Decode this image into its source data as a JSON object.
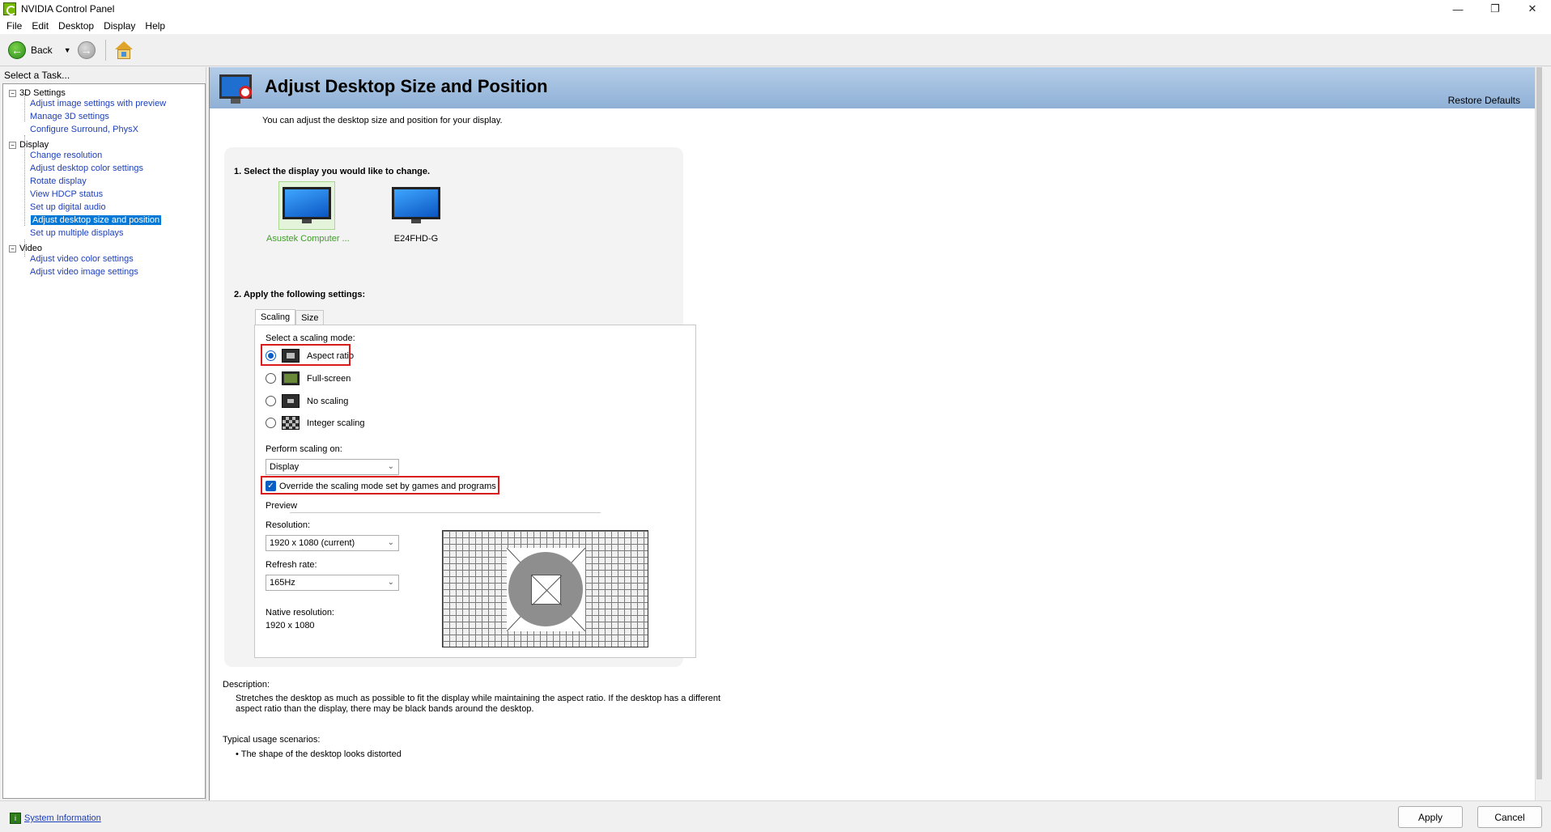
{
  "window": {
    "title": "NVIDIA Control Panel",
    "minimize": "—",
    "maximize": "❐",
    "close": "✕"
  },
  "menu": [
    "File",
    "Edit",
    "Desktop",
    "Display",
    "Help"
  ],
  "toolbar": {
    "back_label": "Back"
  },
  "sidebar": {
    "header": "Select a Task...",
    "groups": [
      {
        "label": "3D Settings",
        "items": [
          "Adjust image settings with preview",
          "Manage 3D settings",
          "Configure Surround, PhysX"
        ]
      },
      {
        "label": "Display",
        "items": [
          "Change resolution",
          "Adjust desktop color settings",
          "Rotate display",
          "View HDCP status",
          "Set up digital audio",
          "Adjust desktop size and position",
          "Set up multiple displays"
        ]
      },
      {
        "label": "Video",
        "items": [
          "Adjust video color settings",
          "Adjust video image settings"
        ]
      }
    ],
    "selected_item": "Adjust desktop size and position"
  },
  "main": {
    "title": "Adjust Desktop Size and Position",
    "restore_defaults": "Restore Defaults",
    "intro": "You can adjust the desktop size and position for your display.",
    "step1": "1. Select the display you would like to change.",
    "displays": [
      {
        "name": "Asustek Computer ...",
        "selected": true
      },
      {
        "name": "E24FHD-G",
        "selected": false
      }
    ],
    "step2": "2. Apply the following settings:",
    "tabs": [
      "Scaling",
      "Size"
    ],
    "active_tab": "Scaling",
    "scaling_mode_label": "Select a scaling mode:",
    "scaling_modes": [
      {
        "label": "Aspect ratio",
        "selected": true,
        "icon": "aspect-ratio-icon"
      },
      {
        "label": "Full-screen",
        "selected": false,
        "icon": "full-screen-icon"
      },
      {
        "label": "No scaling",
        "selected": false,
        "icon": "no-scaling-icon"
      },
      {
        "label": "Integer scaling",
        "selected": false,
        "icon": "integer-scaling-icon"
      }
    ],
    "perform_scaling_label": "Perform scaling on:",
    "perform_scaling_value": "Display",
    "override_label": "Override the scaling mode set by games and programs",
    "override_checked": true,
    "preview_label": "Preview",
    "resolution_label": "Resolution:",
    "resolution_value": "1920 x 1080 (current)",
    "refresh_label": "Refresh rate:",
    "refresh_value": "165Hz",
    "native_label": "Native resolution:",
    "native_value": "1920 x 1080",
    "description_label": "Description:",
    "description_line1": "Stretches the desktop as much as possible to fit the display while maintaining the aspect ratio. If the desktop has a different",
    "description_line2": "aspect ratio than the display, there may be black bands around the desktop.",
    "usage_label": "Typical usage scenarios:",
    "usage_item": "The shape of the desktop looks distorted"
  },
  "footer": {
    "system_info": "System Information",
    "apply": "Apply",
    "cancel": "Cancel"
  },
  "colors": {
    "highlight_red": "#d81b1b",
    "selection_blue": "#0078d7",
    "link_blue": "#1c3fbd",
    "nvidia_green": "#76b900"
  }
}
